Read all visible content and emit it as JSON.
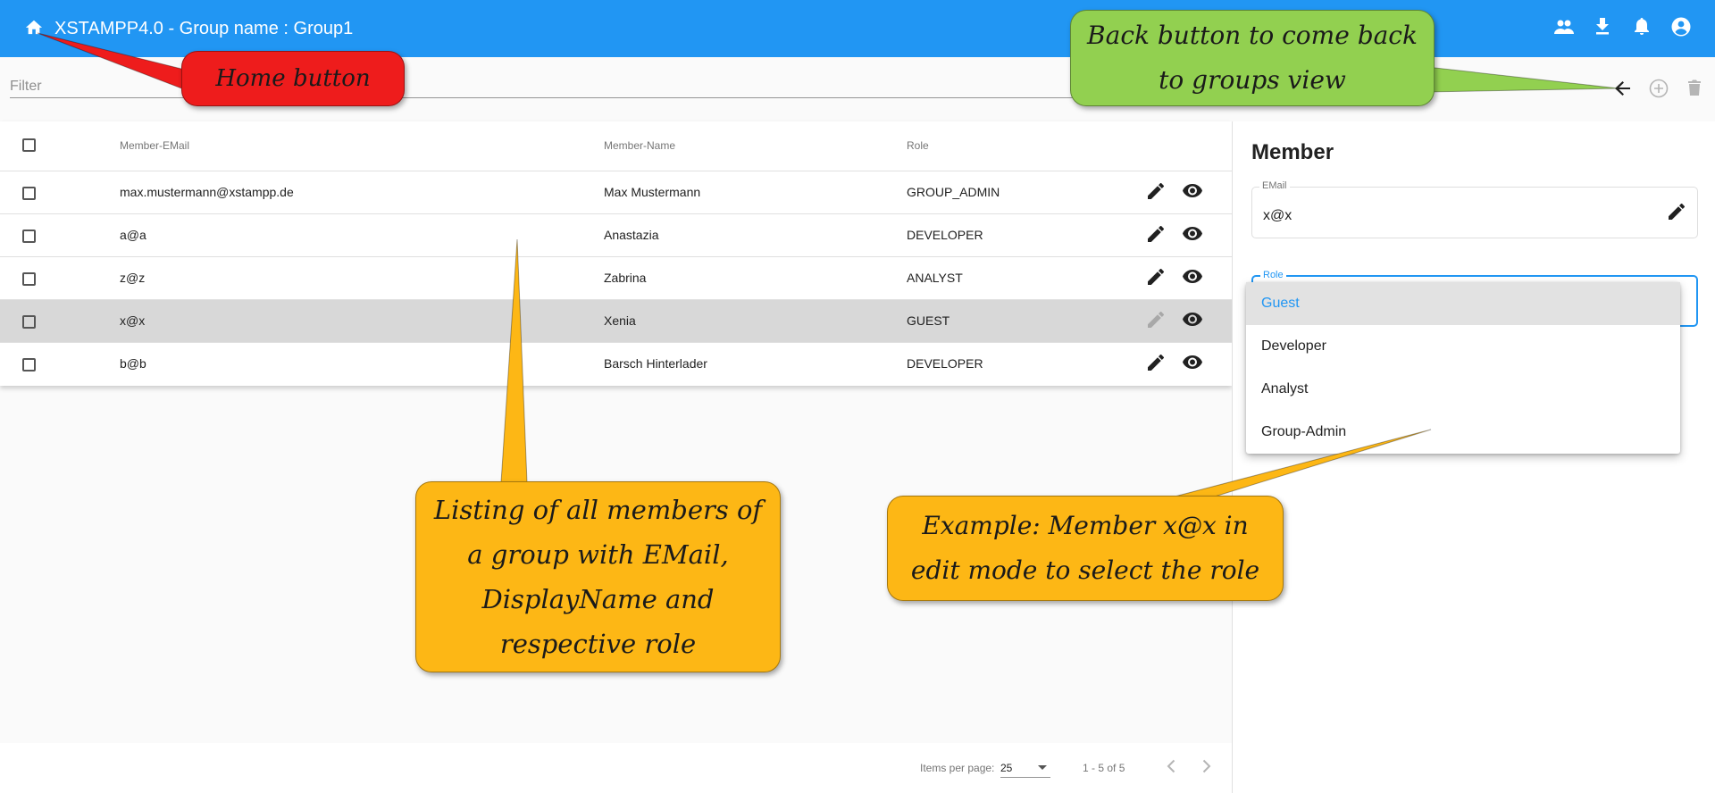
{
  "app": {
    "title": "XSTAMPP4.0 - Group name : Group1",
    "icons": [
      "home-icon",
      "group-icon",
      "download-icon",
      "bell-icon",
      "account-icon"
    ]
  },
  "filter": {
    "placeholder": "Filter"
  },
  "table": {
    "headers": {
      "email": "Member-EMail",
      "name": "Member-Name",
      "role": "Role"
    },
    "rows": [
      {
        "email": "max.mustermann@xstampp.de",
        "name": "Max Mustermann",
        "role": "GROUP_ADMIN"
      },
      {
        "email": "a@a",
        "name": "Anastazia",
        "role": "DEVELOPER"
      },
      {
        "email": "z@z",
        "name": "Zabrina",
        "role": "ANALYST"
      },
      {
        "email": "x@x",
        "name": "Xenia",
        "role": "GUEST"
      },
      {
        "email": "b@b",
        "name": "Barsch Hinterlader",
        "role": "DEVELOPER"
      }
    ],
    "selected_row": 3
  },
  "paginator": {
    "items_per_page_label": "Items per page:",
    "items_per_page": "25",
    "range": "1 - 5 of 5"
  },
  "member_panel": {
    "title": "Member",
    "email_label": "EMail",
    "email_value": "x@x",
    "role_label": "Role",
    "role_options": [
      "Guest",
      "Developer",
      "Analyst",
      "Group-Admin"
    ],
    "role_selected": "Guest"
  },
  "annotations": {
    "home": "Home button",
    "back": "Back button to come back to groups view",
    "listing": "Listing of all members of a group with EMail, DisplayName and respective role",
    "example": "Example: Member x@x in edit mode to select the role"
  },
  "colors": {
    "toolbar": "#2196f3",
    "annotation_red": "#ee1c1c",
    "annotation_green": "#92d050",
    "annotation_orange": "#fdb715",
    "selected_row": "#d8d8d8"
  }
}
